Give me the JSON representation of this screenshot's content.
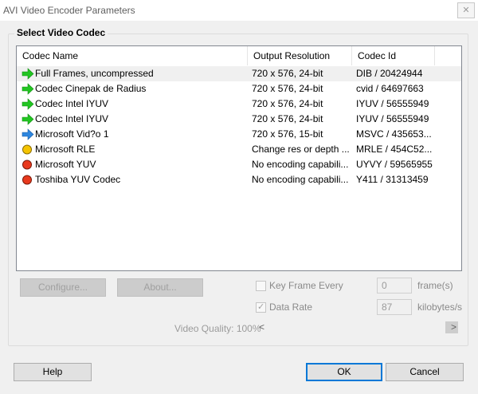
{
  "window": {
    "title": "AVI Video Encoder Parameters",
    "close_glyph": "✕"
  },
  "group": {
    "title": "Select Video Codec"
  },
  "list": {
    "columns": [
      "Codec Name",
      "Output Resolution",
      "Codec Id"
    ],
    "rows": [
      {
        "icon": "green-arrow-icon",
        "name": "Full Frames, uncompressed",
        "resolution": "720 x 576, 24-bit",
        "codec_id": "DIB  / 20424944",
        "selected": true
      },
      {
        "icon": "green-arrow-icon",
        "name": "Codec Cinepak de Radius",
        "resolution": "720 x 576, 24-bit",
        "codec_id": "cvid / 64697663"
      },
      {
        "icon": "green-arrow-icon",
        "name": "Codec Intel IYUV",
        "resolution": "720 x 576, 24-bit",
        "codec_id": "IYUV / 56555949"
      },
      {
        "icon": "green-arrow-icon",
        "name": "Codec Intel IYUV",
        "resolution": "720 x 576, 24-bit",
        "codec_id": "IYUV / 56555949"
      },
      {
        "icon": "blue-arrow-icon",
        "name": "Microsoft Vid?o 1",
        "resolution": "720 x 576, 15-bit",
        "codec_id": "MSVC / 435653..."
      },
      {
        "icon": "yellow-circle-icon",
        "name": "Microsoft RLE",
        "resolution": "Change res or depth ...",
        "codec_id": "MRLE / 454C52..."
      },
      {
        "icon": "red-circle-icon",
        "name": "Microsoft YUV",
        "resolution": "No encoding capabili...",
        "codec_id": "UYVY / 59565955"
      },
      {
        "icon": "red-circle-icon",
        "name": "Toshiba YUV Codec",
        "resolution": "No encoding capabili...",
        "codec_id": "Y411 / 31313459"
      }
    ]
  },
  "buttons": {
    "configure": "Configure...",
    "about": "About...",
    "help": "Help",
    "ok": "OK",
    "cancel": "Cancel"
  },
  "keyframe": {
    "label": "Key Frame Every",
    "checked": false,
    "value": "0",
    "unit": "frame(s)"
  },
  "datarate": {
    "label": "Data Rate",
    "checked": true,
    "checkmark": "✓",
    "value": "87",
    "unit": "kilobytes/s"
  },
  "quality": {
    "label": "Video Quality: 100%",
    "value_percent": 100,
    "left_arrow": "<",
    "right_arrow": ">"
  },
  "colors": {
    "accent": "#0078d7",
    "green_arrow": "#22c522",
    "blue_arrow": "#2e86de",
    "yellow": "#f5c400",
    "red": "#e8391d"
  }
}
